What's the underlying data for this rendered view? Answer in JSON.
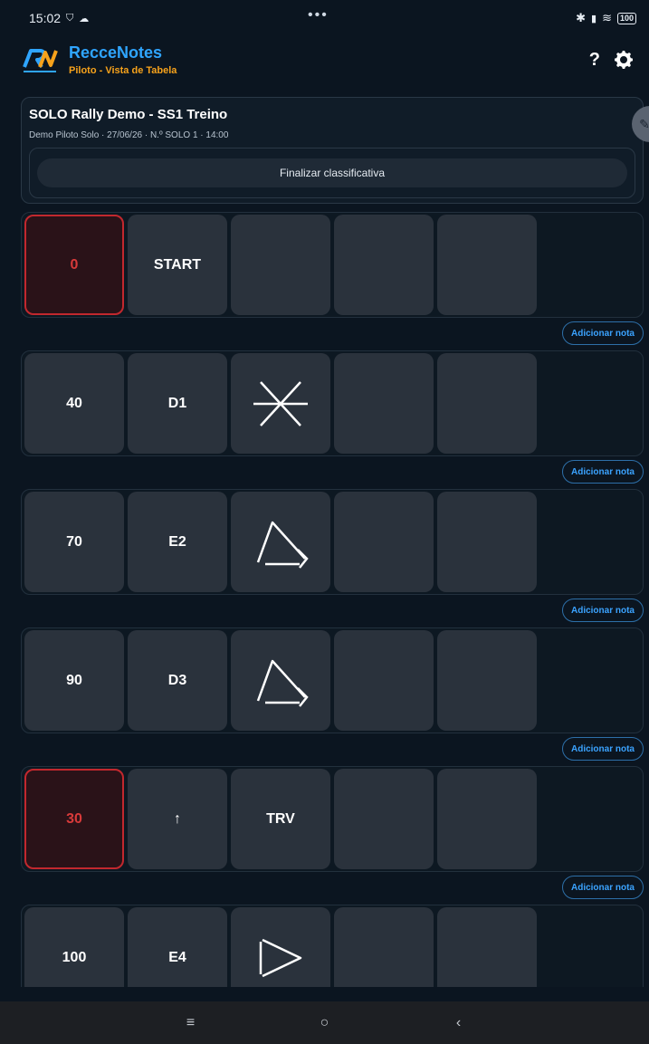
{
  "status": {
    "time": "15:02",
    "dots": "•••",
    "battery": "100"
  },
  "app": {
    "title": "RecceNotes",
    "subtitle": "Piloto - Vista de Tabela",
    "help_label": "?"
  },
  "stage": {
    "title": "SOLO Rally Demo - SS1 Treino",
    "meta": "Demo Piloto Solo · 27/06/26 · N.º SOLO 1 · 14:00",
    "finish_label": "Finalizar classificativa"
  },
  "add_note_label": "Adicionar nota",
  "rows": [
    {
      "distance": "0",
      "distance_alert": true,
      "c2": "START",
      "c3_icon": null
    },
    {
      "distance": "40",
      "distance_alert": false,
      "c2": "D1",
      "c3_icon": "cross-icon"
    },
    {
      "distance": "70",
      "distance_alert": false,
      "c2": "E2",
      "c3_icon": "hairpin-right-icon"
    },
    {
      "distance": "90",
      "distance_alert": false,
      "c2": "D3",
      "c3_icon": "hairpin-right-icon"
    },
    {
      "distance": "30",
      "distance_alert": true,
      "c2": "↑",
      "c3_text": "TRV"
    },
    {
      "distance": "100",
      "distance_alert": false,
      "c2": "E4",
      "c3_icon": "open-right-icon"
    }
  ],
  "nav": {
    "menu": "≡",
    "home": "○",
    "back": "‹"
  },
  "colors": {
    "background": "#0b1520",
    "accent_blue": "#2fa5ff",
    "accent_orange": "#f7a21b",
    "alert_red": "#c2282e",
    "cell": "#2a323c"
  }
}
